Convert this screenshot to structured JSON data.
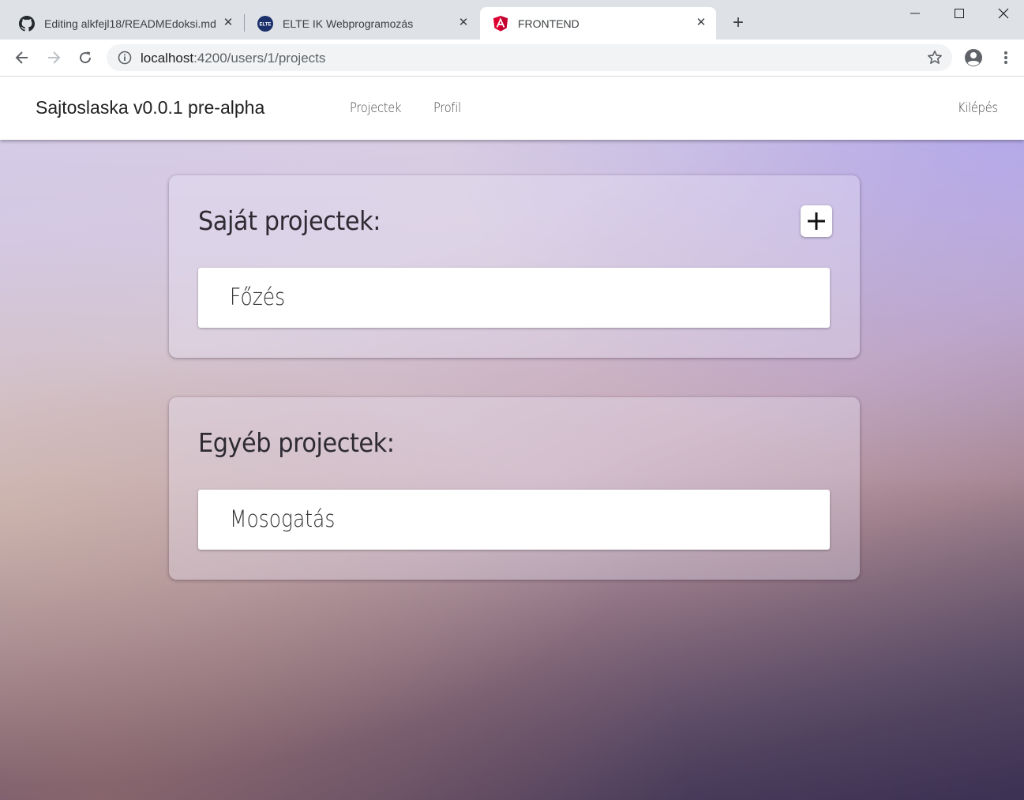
{
  "browser": {
    "tabs": [
      {
        "title": "Editing alkfejl18/READMEdoksi.md",
        "favicon": "github-icon",
        "active": false
      },
      {
        "title": "ELTE IK Webprogramozás",
        "favicon": "elte-icon",
        "active": false
      },
      {
        "title": "FRONTEND",
        "favicon": "angular-icon",
        "active": true
      }
    ],
    "address": {
      "host": "localhost",
      "path": ":4200/users/1/projects"
    }
  },
  "navbar": {
    "brand": "Sajtoslaska v0.0.1 pre-alpha",
    "links": [
      "Projectek",
      "Profil"
    ],
    "logout": "Kilépés"
  },
  "own_projects": {
    "heading": "Saját projectek:",
    "items": [
      "Főzés"
    ],
    "add_icon": "plus-icon"
  },
  "other_projects": {
    "heading": "Egyéb projectek:",
    "items": [
      "Mosogatás"
    ]
  },
  "colors": {
    "tab_strip": "#dee1e6",
    "angular_red": "#dd0031",
    "elte_blue": "#1b2f6b"
  }
}
